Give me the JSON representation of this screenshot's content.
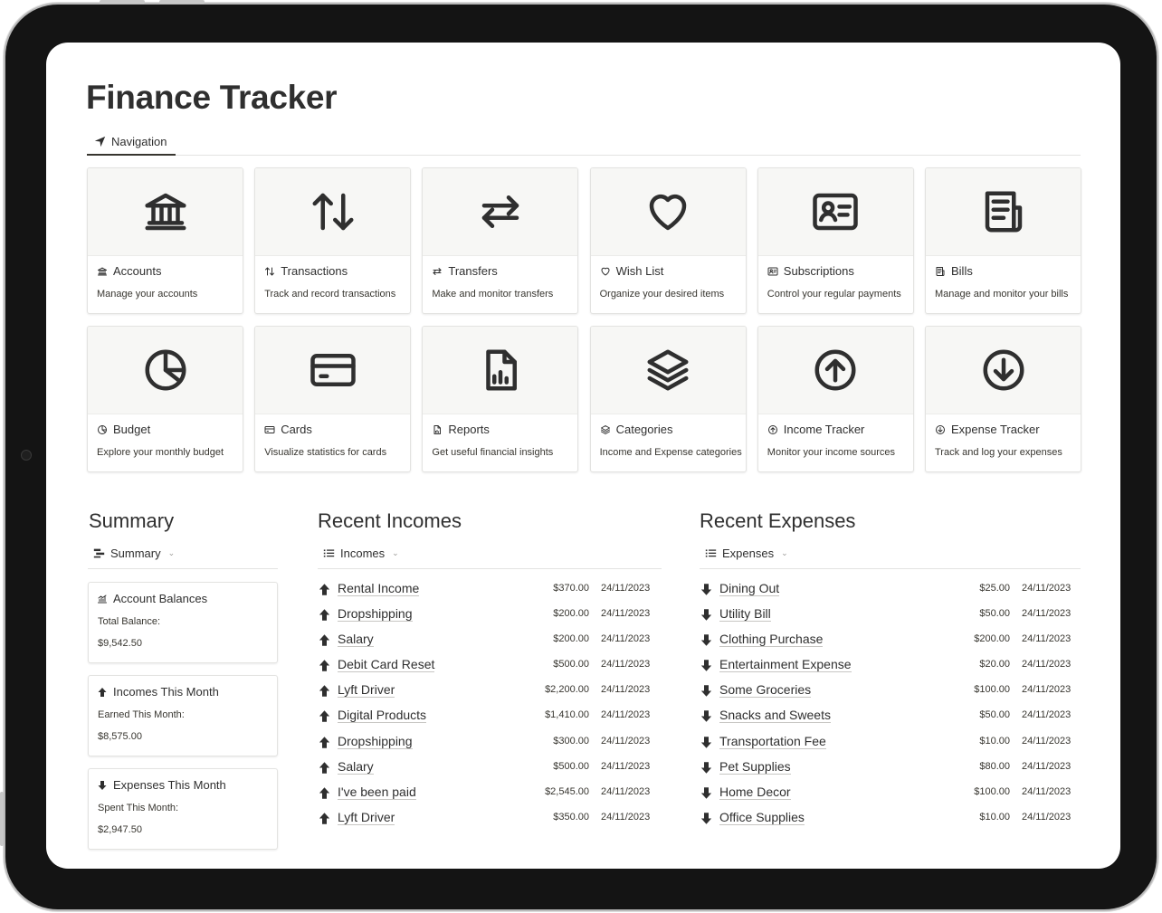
{
  "page_title": "Finance Tracker",
  "nav_tab": {
    "label": "Navigation",
    "icon": "navigation-arrow-icon"
  },
  "nav_cards": [
    {
      "title": "Accounts",
      "description": "Manage your accounts",
      "icon": "bank-icon"
    },
    {
      "title": "Transactions",
      "description": "Track and record transactions",
      "icon": "arrows-up-down-icon"
    },
    {
      "title": "Transfers",
      "description": "Make and monitor transfers",
      "icon": "arrows-left-right-icon"
    },
    {
      "title": "Wish List",
      "description": "Organize your desired items",
      "icon": "heart-icon"
    },
    {
      "title": "Subscriptions",
      "description": "Control your regular payments",
      "icon": "id-card-icon"
    },
    {
      "title": "Bills",
      "description": "Manage and monitor your bills",
      "icon": "receipt-icon"
    },
    {
      "title": "Budget",
      "description": "Explore your monthly budget",
      "icon": "pie-chart-icon"
    },
    {
      "title": "Cards",
      "description": "Visualize statistics for cards",
      "icon": "credit-card-icon"
    },
    {
      "title": "Reports",
      "description": "Get useful financial insights",
      "icon": "report-icon"
    },
    {
      "title": "Categories",
      "description": "Income and Expense categories",
      "icon": "layers-icon"
    },
    {
      "title": "Income Tracker",
      "description": "Monitor your income sources",
      "icon": "arrow-up-circle-icon"
    },
    {
      "title": "Expense Tracker",
      "description": "Track and log your expenses",
      "icon": "arrow-down-circle-icon"
    }
  ],
  "summary": {
    "title": "Summary",
    "view_label": "Summary",
    "cards": [
      {
        "title": "Account Balances",
        "label": "Total Balance:",
        "value": "$9,542.50",
        "icon": "balance-chart-icon"
      },
      {
        "title": "Incomes This Month",
        "label": "Earned This Month:",
        "value": "$8,575.00",
        "icon": "arrow-up-icon"
      },
      {
        "title": "Expenses This Month",
        "label": "Spent This Month:",
        "value": "$2,947.50",
        "icon": "arrow-down-icon"
      }
    ]
  },
  "incomes": {
    "title": "Recent Incomes",
    "view_label": "Incomes",
    "rows": [
      {
        "name": "Rental Income",
        "amount": "$370.00",
        "date": "24/11/2023"
      },
      {
        "name": "Dropshipping",
        "amount": "$200.00",
        "date": "24/11/2023"
      },
      {
        "name": "Salary",
        "amount": "$200.00",
        "date": "24/11/2023"
      },
      {
        "name": "Debit Card Reset",
        "amount": "$500.00",
        "date": "24/11/2023"
      },
      {
        "name": "Lyft Driver",
        "amount": "$2,200.00",
        "date": "24/11/2023"
      },
      {
        "name": "Digital Products",
        "amount": "$1,410.00",
        "date": "24/11/2023"
      },
      {
        "name": "Dropshipping",
        "amount": "$300.00",
        "date": "24/11/2023"
      },
      {
        "name": "Salary",
        "amount": "$500.00",
        "date": "24/11/2023"
      },
      {
        "name": "I've been paid",
        "amount": "$2,545.00",
        "date": "24/11/2023"
      },
      {
        "name": "Lyft Driver",
        "amount": "$350.00",
        "date": "24/11/2023"
      }
    ]
  },
  "expenses": {
    "title": "Recent Expenses",
    "view_label": "Expenses",
    "rows": [
      {
        "name": "Dining Out",
        "amount": "$25.00",
        "date": "24/11/2023"
      },
      {
        "name": "Utility Bill",
        "amount": "$50.00",
        "date": "24/11/2023"
      },
      {
        "name": "Clothing Purchase",
        "amount": "$200.00",
        "date": "24/11/2023"
      },
      {
        "name": "Entertainment Expense",
        "amount": "$20.00",
        "date": "24/11/2023"
      },
      {
        "name": "Some Groceries",
        "amount": "$100.00",
        "date": "24/11/2023"
      },
      {
        "name": "Snacks and Sweets",
        "amount": "$50.00",
        "date": "24/11/2023"
      },
      {
        "name": "Transportation Fee",
        "amount": "$10.00",
        "date": "24/11/2023"
      },
      {
        "name": "Pet Supplies",
        "amount": "$80.00",
        "date": "24/11/2023"
      },
      {
        "name": "Home Decor",
        "amount": "$100.00",
        "date": "24/11/2023"
      },
      {
        "name": "Office Supplies",
        "amount": "$10.00",
        "date": "24/11/2023"
      }
    ]
  }
}
